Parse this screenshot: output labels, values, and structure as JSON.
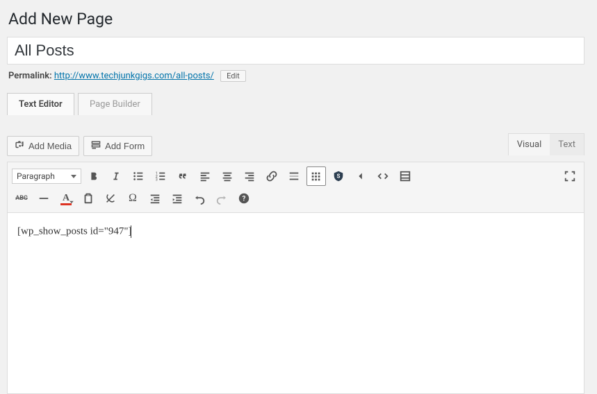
{
  "header": {
    "page_title": "Add New Page"
  },
  "post": {
    "title": "All Posts",
    "permalink_label": "Permalink:",
    "permalink_url": "http://www.techjunkgigs.com/all-posts/",
    "permalink_edit": "Edit"
  },
  "builder_tabs": {
    "text_editor": "Text Editor",
    "page_builder": "Page Builder"
  },
  "media": {
    "add_media": "Add Media",
    "add_form": "Add Form"
  },
  "view_tabs": {
    "visual": "Visual",
    "text": "Text"
  },
  "toolbar": {
    "format_label": "Paragraph",
    "icons": [
      "bold-icon",
      "italic-icon",
      "bullet-list-icon",
      "numbered-list-icon",
      "quote-icon",
      "align-left-icon",
      "align-center-icon",
      "align-right-icon",
      "link-icon",
      "insert-more-icon",
      "toolbar-toggle-icon",
      "shield-icon",
      "caret-left-icon",
      "code-icon",
      "blocks-icon"
    ],
    "icons2": [
      "strikethrough-icon",
      "hr-icon",
      "text-color-icon",
      "paste-text-icon",
      "clear-format-icon",
      "special-char-icon",
      "outdent-icon",
      "indent-icon",
      "undo-icon",
      "redo-icon",
      "help-icon"
    ],
    "distraction_free": "distraction-free-icon"
  },
  "content": "[wp_show_posts id=\"947\"]"
}
